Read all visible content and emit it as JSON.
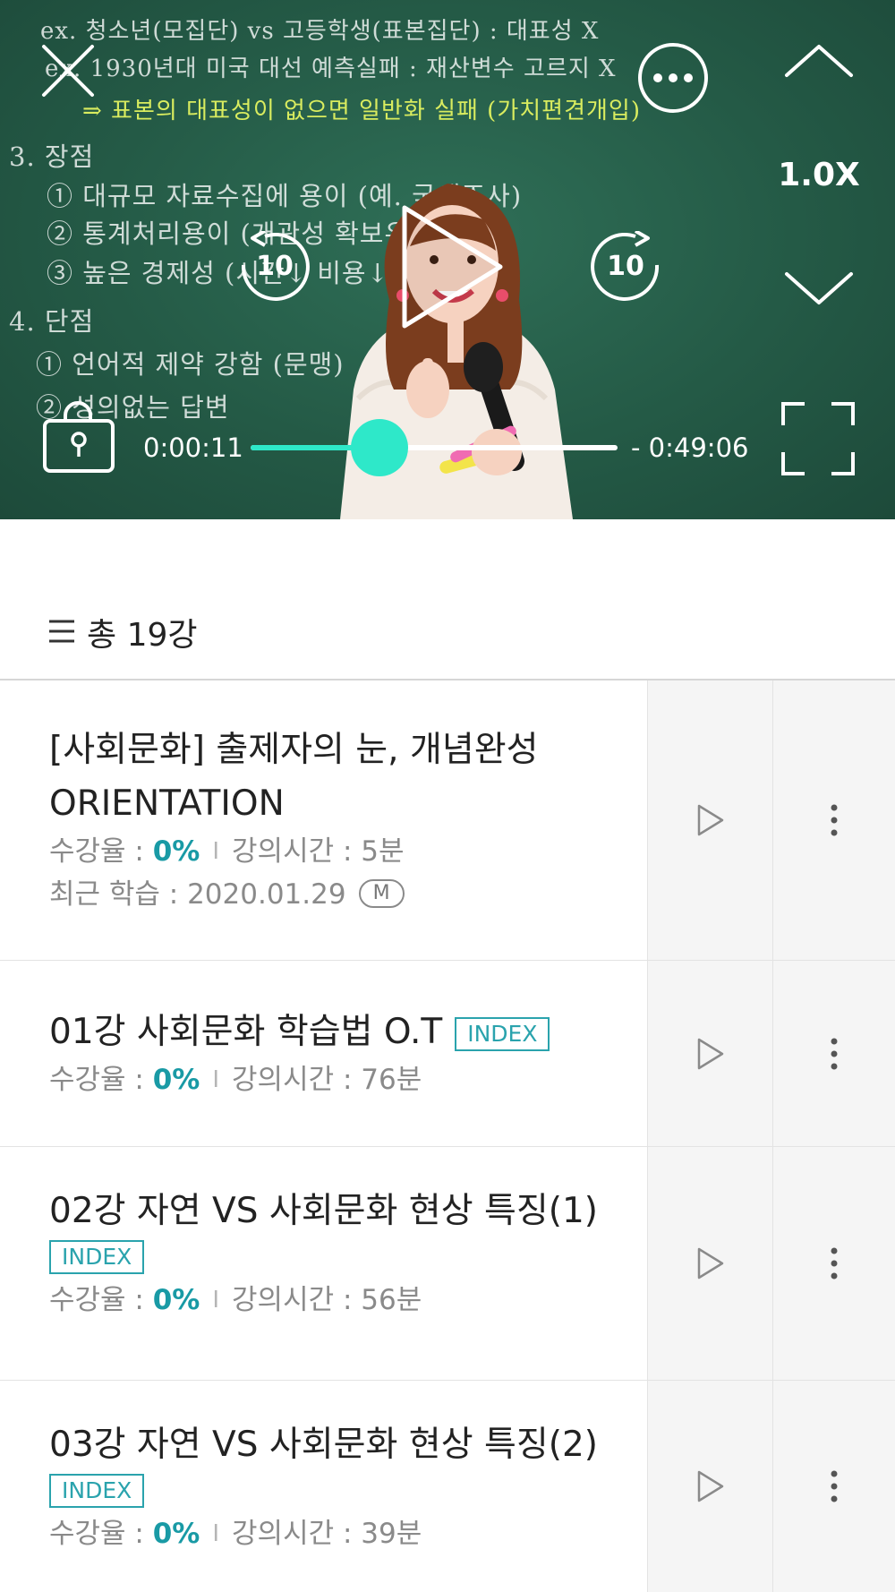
{
  "player": {
    "chalkboard": {
      "lines": [
        "ex. 청소년(모집단) vs 고등학생(표본집단) : 대표성 X",
        "ex. 1930년대 미국 대선 예측실패 : 재산변수 고르지 X",
        "⇒ 표본의 대표성이 없으면 일반화 실패 (가치편견개입)",
        "3. 장점",
        "① 대규모 자료수집에 용이 (예. 국세조사)",
        "② 통계처리용이 (개관성 확보유리)",
        "③ 높은 경제성 (시간↓ 비용↓)",
        "4. 단점",
        "① 언어적 제약 강함 (문맹)",
        "② 성의없는 답변"
      ]
    },
    "speed": "1.0X",
    "rewind_label": "10",
    "forward_label": "10",
    "time_current": "0:00:11",
    "time_remaining": "- 0:49:06",
    "progress": 0.35,
    "accent_color": "#2ee8c9"
  },
  "list": {
    "total_label": "총 19강",
    "items": [
      {
        "title_line1": "[사회문화] 출제자의 눈, 개념완성",
        "title_line2": "ORIENTATION",
        "rate_label": "수강율 : ",
        "rate": "0%",
        "sep": "I",
        "time_label": "강의시간 : 5분",
        "recent_label": "최근 학습 : 2020.01.29",
        "m_badge": "M"
      },
      {
        "title": "01강 사회문화 학습법 O.T",
        "badge": "INDEX",
        "rate_label": "수강율 : ",
        "rate": "0%",
        "sep": "I",
        "time_label": "강의시간 : 76분"
      },
      {
        "title": "02강 자연 VS 사회문화 현상 특징(1)",
        "badge": "INDEX",
        "rate_label": "수강율 : ",
        "rate": "0%",
        "sep": "I",
        "time_label": "강의시간 : 56분"
      },
      {
        "title": "03강 자연 VS 사회문화 현상 특징(2)",
        "badge": "INDEX",
        "rate_label": "수강율 : ",
        "rate": "0%",
        "sep": "I",
        "time_label": "강의시간 : 39분"
      }
    ]
  },
  "icons": {
    "close": "close-icon",
    "more": "more-horizontal-icon",
    "up": "chevron-up-icon",
    "down": "chevron-down-icon",
    "rewind": "rewind-10-icon",
    "forward": "forward-10-icon",
    "play": "play-icon",
    "lock": "lock-icon",
    "fullscreen": "fullscreen-icon",
    "menu": "menu-icon",
    "kebab": "more-vertical-icon"
  }
}
